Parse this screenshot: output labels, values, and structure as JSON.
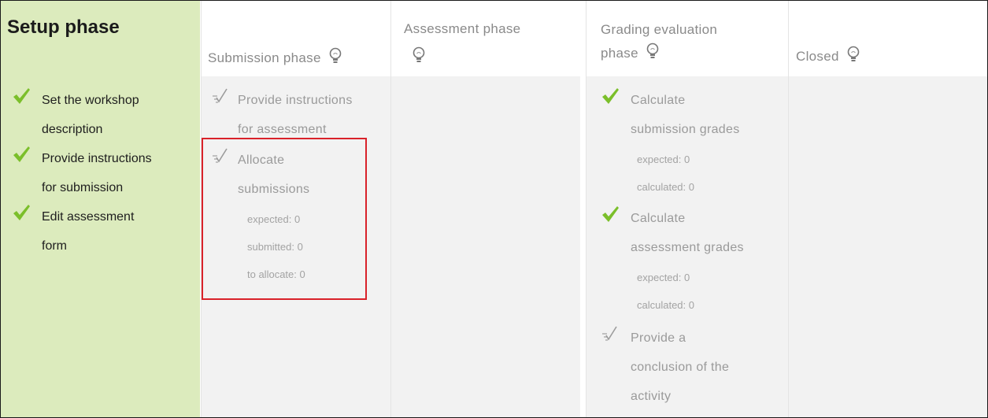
{
  "colors": {
    "setup_bg": "#dcebbd",
    "phase_bg": "#f2f2f2",
    "check_green": "#7bbf2a",
    "highlight_red": "#d9222a"
  },
  "phases": {
    "setup": {
      "title": "Setup phase",
      "tasks": [
        {
          "icon": "check-icon",
          "lines": [
            "Set the workshop",
            "description"
          ]
        },
        {
          "icon": "check-icon",
          "lines": [
            "Provide instructions",
            "for submission"
          ]
        },
        {
          "icon": "check-icon",
          "lines": [
            "Edit assessment",
            "form"
          ]
        }
      ]
    },
    "submission": {
      "title": "Submission phase",
      "icon": "lightbulb-icon",
      "tasks": [
        {
          "icon": "todo-icon",
          "lines": [
            "Provide instructions",
            "for assessment"
          ]
        },
        {
          "icon": "todo-icon",
          "lines": [
            "Allocate",
            "submissions"
          ],
          "details": [
            "expected: 0",
            "submitted: 0",
            "to allocate: 0"
          ]
        }
      ]
    },
    "assessment": {
      "title": "Assessment phase",
      "icon": "lightbulb-icon"
    },
    "grading": {
      "title_lines": [
        "Grading evaluation",
        "phase"
      ],
      "icon": "lightbulb-icon",
      "tasks": [
        {
          "icon": "check-icon",
          "lines": [
            "Calculate",
            "submission grades"
          ],
          "details": [
            "expected: 0",
            "calculated: 0"
          ]
        },
        {
          "icon": "check-icon",
          "lines": [
            "Calculate",
            "assessment grades"
          ],
          "details": [
            "expected: 0",
            "calculated: 0"
          ]
        },
        {
          "icon": "todo-icon",
          "lines": [
            "Provide a",
            "conclusion of the",
            "activity"
          ]
        }
      ]
    },
    "closed": {
      "title": "Closed",
      "icon": "lightbulb-icon"
    }
  }
}
